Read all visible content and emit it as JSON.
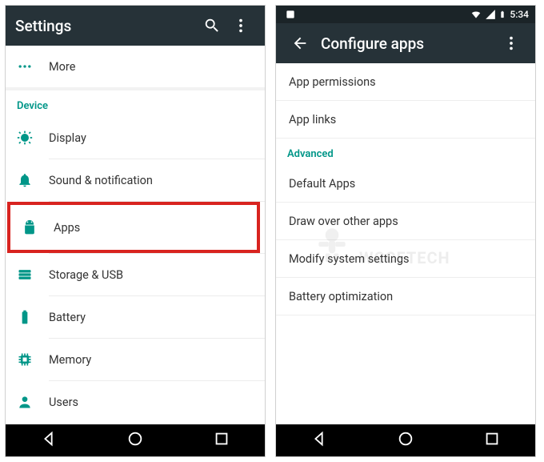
{
  "left": {
    "title": "Settings",
    "more": "More",
    "section_device": "Device",
    "items": [
      {
        "label": "Display"
      },
      {
        "label": "Sound & notification"
      },
      {
        "label": "Apps"
      },
      {
        "label": "Storage & USB"
      },
      {
        "label": "Battery"
      },
      {
        "label": "Memory"
      },
      {
        "label": "Users"
      }
    ]
  },
  "right": {
    "status_time": "5:34",
    "title": "Configure apps",
    "rows": [
      "App permissions",
      "App links"
    ],
    "section_advanced": "Advanced",
    "adv_rows": [
      "Default Apps",
      "Draw over other apps",
      "Modify system settings",
      "Battery optimization"
    ]
  },
  "watermark": "WCCFTECH"
}
